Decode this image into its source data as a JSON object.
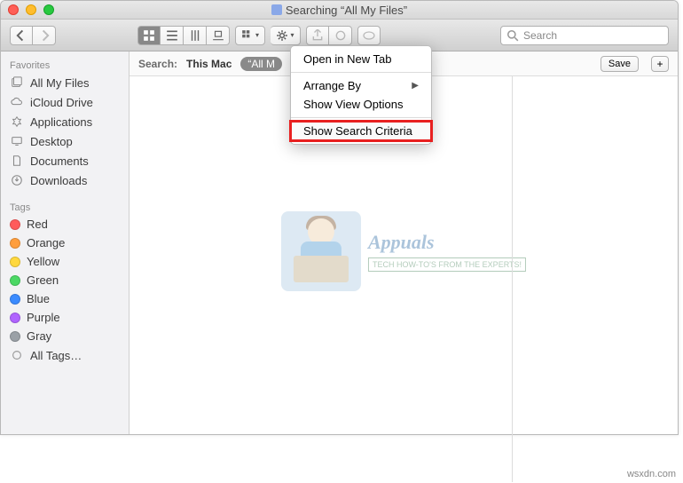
{
  "window": {
    "title": "Searching “All My Files”"
  },
  "search_field": {
    "placeholder": "Search"
  },
  "sidebar": {
    "favorites_header": "Favorites",
    "favorites": [
      {
        "label": "All My Files"
      },
      {
        "label": "iCloud Drive"
      },
      {
        "label": "Applications"
      },
      {
        "label": "Desktop"
      },
      {
        "label": "Documents"
      },
      {
        "label": "Downloads"
      }
    ],
    "tags_header": "Tags",
    "tags": [
      {
        "label": "Red",
        "color": "#ff5b5b"
      },
      {
        "label": "Orange",
        "color": "#ff9e3d"
      },
      {
        "label": "Yellow",
        "color": "#ffd83d"
      },
      {
        "label": "Green",
        "color": "#4bd864"
      },
      {
        "label": "Blue",
        "color": "#3b8bff"
      },
      {
        "label": "Purple",
        "color": "#b064ff"
      },
      {
        "label": "Gray",
        "color": "#9aa0a6"
      }
    ],
    "all_tags_label": "All Tags…"
  },
  "searchbar": {
    "label": "Search:",
    "scope_this_mac": "This Mac",
    "scope_all_my": "“All M",
    "save_label": "Save",
    "plus_label": "+"
  },
  "menu": {
    "open_new_tab": "Open in New Tab",
    "arrange_by": "Arrange By",
    "show_view_options": "Show View Options",
    "show_search_criteria": "Show Search Criteria"
  },
  "watermark": {
    "title": "Appuals",
    "subtitle": "TECH HOW-TO'S FROM THE EXPERTS!"
  },
  "credit": "wsxdn.com"
}
